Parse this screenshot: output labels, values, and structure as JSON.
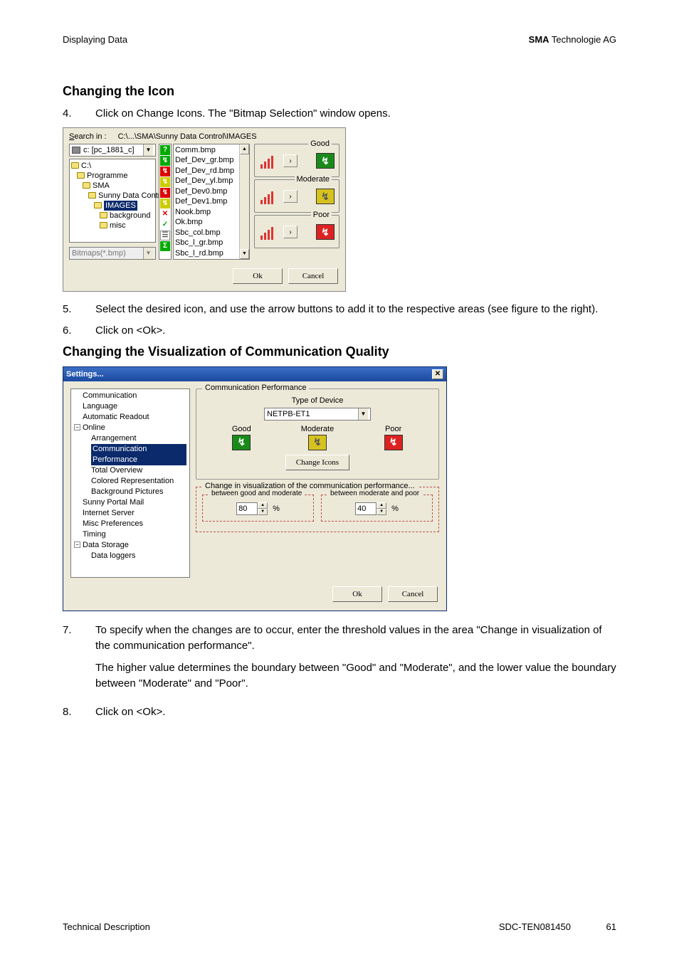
{
  "header": {
    "left": "Displaying Data",
    "right_bold": "SMA",
    "right_rest": " Technologie AG"
  },
  "section1_heading": "Changing the Icon",
  "step4": {
    "num": "4.",
    "text": "Click on Change Icons. The \"Bitmap Selection\" window opens."
  },
  "bmpwin": {
    "search_label": "Search in :",
    "search_path": "C:\\...\\SMA\\Sunny Data Control\\IMAGES",
    "drive": "c: [pc_1881_c]",
    "tree": [
      "C:\\",
      "Programme",
      "SMA",
      "Sunny Data Control",
      "IMAGES",
      "background",
      "misc"
    ],
    "filter": "Bitmaps(*.bmp)",
    "files": [
      "Comm.bmp",
      "Def_Dev_gr.bmp",
      "Def_Dev_rd.bmp",
      "Def_Dev_yl.bmp",
      "Def_Dev0.bmp",
      "Def_Dev1.bmp",
      "Nook.bmp",
      "Ok.bmp",
      "Sbc_col.bmp",
      "Sbc_l_gr.bmp",
      "Sbc_l_rd.bmp"
    ],
    "cats": {
      "good": "Good",
      "moderate": "Moderate",
      "poor": "Poor"
    },
    "ok": "Ok",
    "cancel": "Cancel"
  },
  "step5": {
    "num": "5.",
    "text": "Select the desired icon, and use the arrow buttons to add it to the respective areas (see figure to the right)."
  },
  "step6": {
    "num": "6.",
    "text": "Click on <Ok>."
  },
  "section2_heading": "Changing the Visualization of Communication Quality",
  "setwin": {
    "title": "Settings...",
    "tree": {
      "items": [
        "Communication",
        "Language",
        "Automatic Readout",
        "Online",
        "Arrangement",
        "Communication Performance",
        "Total Overview",
        "Colored Representation",
        "Background Pictures",
        "Sunny Portal Mail",
        "Internet Server",
        "Misc Preferences",
        "Timing",
        "Data Storage",
        "Data loggers"
      ]
    },
    "grp1_caption": "Communication Performance",
    "type_label": "Type of Device",
    "type_value": "NETPB-ET1",
    "good": "Good",
    "moderate": "Moderate",
    "poor": "Poor",
    "change_icons": "Change Icons",
    "grp2_caption": "Change in visualization of the communication performance...",
    "box1_caption": "between good and moderate",
    "box1_value": "80",
    "box2_caption": "between moderate and poor",
    "box2_value": "40",
    "percent": "%",
    "ok": "Ok",
    "cancel": "Cancel"
  },
  "step7": {
    "num": "7.",
    "p1": "To specify when the changes are to occur, enter the threshold values in the area \"Change in visualization of the communication performance\".",
    "p2": "The higher value determines the boundary between \"Good\" and \"Moderate\", and the lower value the boundary between \"Moderate\" and \"Poor\"."
  },
  "step8": {
    "num": "8.",
    "text": "Click on <Ok>."
  },
  "footer": {
    "left": "Technical Description",
    "mid": "SDC-TEN081450",
    "right": "61"
  }
}
